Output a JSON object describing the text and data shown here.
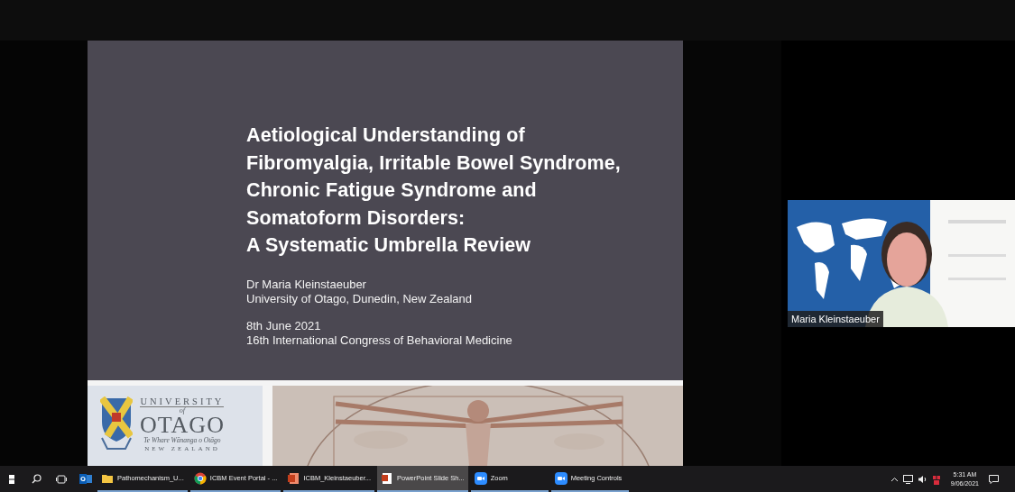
{
  "slide": {
    "title_lines": [
      "Aetiological Understanding of",
      "Fibromyalgia, Irritable Bowel Syndrome,",
      "Chronic Fatigue Syndrome and",
      "Somatoform Disorders:",
      "A Systematic Umbrella Review"
    ],
    "author": "Dr Maria Kleinstaeuber",
    "affiliation": "University of Otago, Dunedin, New Zealand",
    "date": "8th June 2021",
    "event": "16th International Congress of Behavioral Medicine",
    "logo": {
      "top": "UNIVERSITY",
      "of": "of",
      "name": "OTAGO",
      "motto": "Te Whare Wānanga o Otāgo",
      "country": "NEW ZEALAND"
    }
  },
  "video": {
    "participant": "Maria Kleinstaeuber"
  },
  "taskbar": {
    "apps": [
      {
        "kind": "folder",
        "label": "Pathomechanism_U...",
        "selected": false
      },
      {
        "kind": "chrome",
        "label": "ICBM Event Portal - ...",
        "selected": false
      },
      {
        "kind": "powerpoint",
        "label": "ICBM_Kleinstaeuber...",
        "selected": false
      },
      {
        "kind": "slideshow",
        "label": "PowerPoint Slide Sh...",
        "selected": true
      },
      {
        "kind": "zoom",
        "label": "Zoom",
        "selected": false
      },
      {
        "kind": "zoom",
        "label": "Meeting Controls",
        "selected": false
      }
    ],
    "time": "5:31 AM",
    "date": "9/06/2021"
  }
}
